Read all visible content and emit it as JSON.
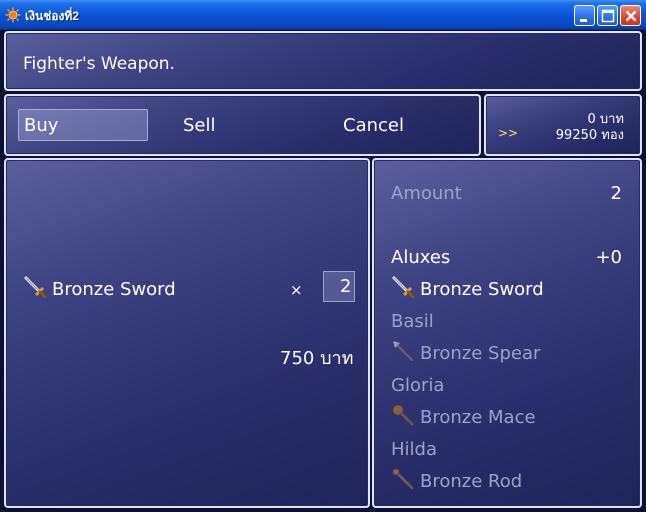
{
  "window": {
    "title": "เงินช่องที่2"
  },
  "help": {
    "text": "Fighter's Weapon."
  },
  "commands": {
    "buy": "Buy",
    "sell": "Sell",
    "cancel": "Cancel"
  },
  "gold": {
    "cursor": ">>",
    "line1": "0 บาท",
    "line2": "99250 ทอง"
  },
  "shop": {
    "item_name": "Bronze Sword",
    "times": "×",
    "quantity": "2",
    "price": "750 บาท"
  },
  "status": {
    "amount_label": "Amount",
    "amount_value": "2",
    "actors": [
      {
        "name": "Aluxes",
        "change": "+0",
        "weapon": "Bronze Sword"
      },
      {
        "name": "Basil",
        "weapon": "Bronze Spear"
      },
      {
        "name": "Gloria",
        "weapon": "Bronze Mace"
      },
      {
        "name": "Hilda",
        "weapon": "Bronze Rod"
      }
    ]
  },
  "icons": [
    "sword-icon",
    "spear-icon",
    "mace-icon",
    "rod-icon"
  ],
  "colors": {
    "accent_cursor": "#ffe45a",
    "disabled_text": "#9da2c8",
    "text": "#ffffff"
  }
}
